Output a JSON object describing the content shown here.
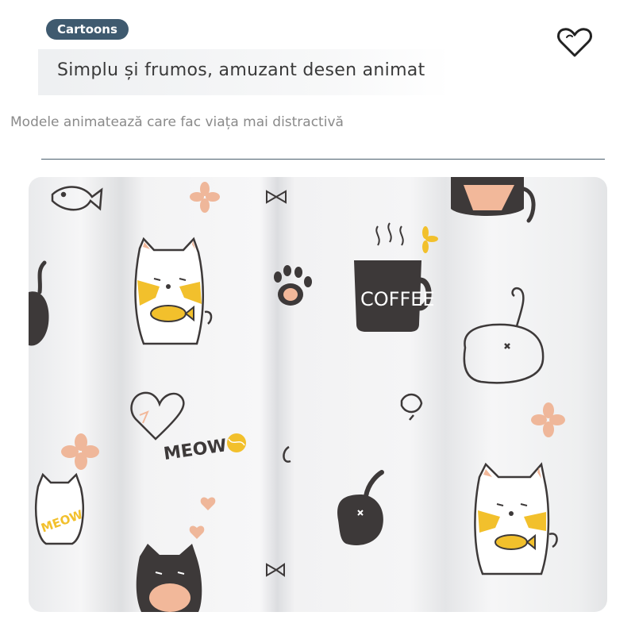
{
  "tag": {
    "label": "Cartoons"
  },
  "title": "Simplu și frumos, amuzant desen animat",
  "subtitle": "Modele animatează care fac viața mai distractivă",
  "favorite_icon": "heart-outline-icon",
  "photo": {
    "description_icons": [
      "cat",
      "fish",
      "paw",
      "coffee-cup",
      "flower",
      "heart"
    ],
    "printed_text": [
      "COFFEE",
      "MEOW",
      "MEOW"
    ]
  },
  "colors": {
    "tag_bg": "#3f5a6f",
    "divider": "#4a5e6e",
    "accent_yellow": "#f2c02c",
    "accent_peach": "#f2b89a",
    "print_dark": "#3d3939"
  }
}
